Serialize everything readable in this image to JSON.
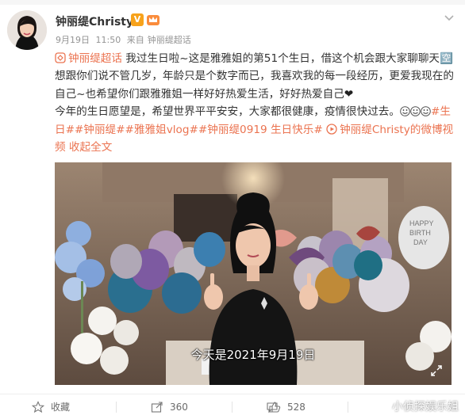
{
  "post": {
    "username": "钟丽缇Christy",
    "vip_badge": "V",
    "date": "9月19日",
    "time": "11:50",
    "source_prefix": "来自",
    "source": "钟丽缇超话",
    "topic_link": "钟丽缇超话",
    "body_1": "我过生日啦~这是雅雅姐的第51个生日，借这个机会跟大家聊聊天🈳想跟你们说不管几岁，年龄只是个数字而已，我喜欢我的每一段经历，更爱我现在的自己~也希望你们跟雅雅姐一样好好热爱生活，好好热爱自己",
    "heart": "❤",
    "body_2": "今年的生日愿望是，希望世界平平安安，大家都很健康，疫情很快过去。",
    "hashtags": "#生日##钟丽缇##雅雅姐vlog##钟丽缇0919 生日快乐#",
    "video_link": "钟丽缇Christy的微博视频",
    "collapse": "收起全文"
  },
  "video": {
    "subtitle": "今天是2021年9月19日",
    "balloon_text": "HAPPY BIRTH DAY"
  },
  "actions": {
    "favorite": "收藏",
    "repost": "360",
    "comment": "",
    "like": "528"
  },
  "watermark": "小侦探娱乐姐",
  "colors": {
    "link": "#eb7350",
    "vip": "#f7a21b",
    "text": "#333333",
    "meta": "#939393"
  }
}
